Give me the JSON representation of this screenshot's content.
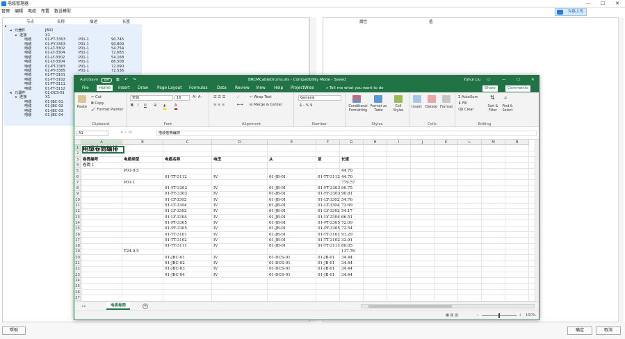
{
  "app": {
    "title": "电缆管理器",
    "window_controls": [
      "—",
      "☐",
      "✕"
    ],
    "menu": [
      "管理",
      "编辑",
      "电缆",
      "布置",
      "数设模型"
    ],
    "upload_button": "沟路上传",
    "left_headers": [
      "节点",
      "名称",
      "描述",
      "长度"
    ],
    "right_headers": [
      "属性",
      "值"
    ],
    "tree": [
      {
        "indent": 0,
        "toggle": "▸",
        "col1": "",
        "col2": "",
        "col3": "",
        "col4": ""
      },
      {
        "indent": 1,
        "toggle": "◂",
        "col1": "元器件",
        "col2": "JB01",
        "col3": "",
        "col4": ""
      },
      {
        "indent": 2,
        "toggle": "◂",
        "col1": "连接",
        "col2": "X1",
        "col3": "",
        "col4": ""
      },
      {
        "indent": 3,
        "toggle": "",
        "col1": "电缆",
        "col2": "01-FT-3303",
        "col3": "P01-1",
        "col4": "90.745"
      },
      {
        "indent": 3,
        "toggle": "",
        "col1": "电缆",
        "col2": "01-FY-3303",
        "col3": "P01-1",
        "col4": "90.809"
      },
      {
        "indent": 3,
        "toggle": "",
        "col1": "电缆",
        "col2": "01-LT-3302",
        "col3": "P01-1",
        "col4": "54.754"
      },
      {
        "indent": 3,
        "toggle": "",
        "col1": "电缆",
        "col2": "01-LT-3304",
        "col3": "P01-1",
        "col4": "72.683"
      },
      {
        "indent": 3,
        "toggle": "",
        "col1": "电缆",
        "col2": "01-LY-3302",
        "col3": "P01-1",
        "col4": "54.168"
      },
      {
        "indent": 3,
        "toggle": "",
        "col1": "电缆",
        "col2": "01-LY-3304",
        "col3": "P01-1",
        "col4": "66.508"
      },
      {
        "indent": 3,
        "toggle": "",
        "col1": "电缆",
        "col2": "01-PT-3305",
        "col3": "P01-1",
        "col4": "72.090"
      },
      {
        "indent": 3,
        "toggle": "",
        "col1": "电缆",
        "col2": "01-PY-3305",
        "col3": "P01-1",
        "col4": "72.536"
      },
      {
        "indent": 3,
        "toggle": "",
        "col1": "电缆",
        "col2": "01-TT-3101",
        "col3": "",
        "col4": ""
      },
      {
        "indent": 3,
        "toggle": "",
        "col1": "电缆",
        "col2": "01-TT-3102",
        "col3": "",
        "col4": ""
      },
      {
        "indent": 3,
        "toggle": "",
        "col1": "电缆",
        "col2": "01-TT-3111",
        "col3": "",
        "col4": ""
      },
      {
        "indent": 3,
        "toggle": "",
        "col1": "电缆",
        "col2": "01-TT-3112",
        "col3": "",
        "col4": ""
      },
      {
        "indent": 1,
        "toggle": "◂",
        "col1": "元器件",
        "col2": "01-DCS-01",
        "col3": "",
        "col4": ""
      },
      {
        "indent": 2,
        "toggle": "◂",
        "col1": "连接",
        "col2": "X1",
        "col3": "",
        "col4": ""
      },
      {
        "indent": 3,
        "toggle": "",
        "col1": "电缆",
        "col2": "01-JBC-01",
        "col3": "",
        "col4": ""
      },
      {
        "indent": 3,
        "toggle": "",
        "col1": "电缆",
        "col2": "01-JBC-02",
        "col3": "",
        "col4": ""
      },
      {
        "indent": 3,
        "toggle": "",
        "col1": "电缆",
        "col2": "01-JBC-03",
        "col3": "",
        "col4": ""
      },
      {
        "indent": 3,
        "toggle": "",
        "col1": "电缆",
        "col2": "01-JBC-04",
        "col3": "",
        "col4": ""
      }
    ],
    "footer": {
      "help": "帮助",
      "ok": "确定",
      "cancel": "取消"
    }
  },
  "excel": {
    "autosave": "AutoSave",
    "autosave_state": "Off",
    "file_title": "BRCMCableDrums.xls  -  Compatibility Mode  -  Saved",
    "user": "Yuhui Liu",
    "tabs": [
      "File",
      "Home",
      "Insert",
      "Draw",
      "Page Layout",
      "Formulas",
      "Data",
      "Review",
      "View",
      "Help",
      "ProjectWise"
    ],
    "active_tab": "Home",
    "tell_me": "Tell me what you want to do",
    "share": "Share",
    "comments": "Comments",
    "ribbon": {
      "paste": "Paste",
      "cut": "Cut",
      "copy": "Copy",
      "format_painter": "Format Painter",
      "clipboard": "Clipboard",
      "font_name": "宋体",
      "font_size": "16",
      "font": "Font",
      "wrap_text": "Wrap Text",
      "merge_center": "Merge & Center",
      "alignment": "Alignment",
      "number_format": "General",
      "number_symbols": "$ - % 9",
      "number": "Number",
      "conditional_formatting": "Conditional Formatting",
      "format_as_table": "Format as Table",
      "cell_styles": "Cell Styles",
      "styles": "Styles",
      "insert": "Insert",
      "delete": "Delete",
      "format": "Format",
      "cells": "Cells",
      "autosum": "AutoSum",
      "fill": "Fill",
      "clear": "Clear",
      "sort_filter": "Sort & Filter",
      "find_select": "Find & Select",
      "editing": "Editing"
    },
    "name_box": "A1",
    "formula": "电缆卷筒编排",
    "columns": [
      "A",
      "B",
      "C",
      "D",
      "E",
      "F",
      "G",
      "H",
      "I",
      "J",
      "K",
      "L",
      "M",
      "N"
    ],
    "rows": [
      {
        "n": "1",
        "a": "电缆卷筒编排",
        "b": "",
        "c": "",
        "d": "",
        "e": "",
        "f": "",
        "g": ""
      },
      {
        "n": "2",
        "a": "",
        "b": "",
        "c": "",
        "d": "",
        "e": "",
        "f": "",
        "g": ""
      },
      {
        "n": "3",
        "a": "卷筒编号",
        "b": "电缆类型",
        "c": "电缆名称",
        "d": "电压",
        "e": "从",
        "f": "至",
        "g": "长度"
      },
      {
        "n": "4",
        "a": "卷筒 1",
        "b": "",
        "c": "",
        "d": "",
        "e": "",
        "f": "",
        "g": ""
      },
      {
        "n": "5",
        "a": "",
        "b": "P01-0.5",
        "c": "",
        "d": "",
        "e": "",
        "f": "",
        "g": "44.70"
      },
      {
        "n": "6",
        "a": "",
        "b": "",
        "c": "01-TT-3112",
        "d": "IV",
        "e": "01-JB-01",
        "f": "01-TT-3112",
        "g": "44.70"
      },
      {
        "n": "7",
        "a": "",
        "b": "P01-1",
        "c": "",
        "d": "",
        "e": "",
        "f": "",
        "g": "779.57"
      },
      {
        "n": "8",
        "a": "",
        "b": "",
        "c": "01-FT-3303",
        "d": "IV",
        "e": "01-JB-01",
        "f": "01-FT-3303",
        "g": "90.75"
      },
      {
        "n": "9",
        "a": "",
        "b": "",
        "c": "01-FY-3303",
        "d": "IV",
        "e": "01-JB-01",
        "f": "01-FY-3303",
        "g": "90.81"
      },
      {
        "n": "10",
        "a": "",
        "b": "",
        "c": "01-LT-3302",
        "d": "IV",
        "e": "01-JB-01",
        "f": "01-LT-3302",
        "g": "54.76"
      },
      {
        "n": "11",
        "a": "",
        "b": "",
        "c": "01-LT-3304",
        "d": "IV",
        "e": "01-JB-01",
        "f": "01-LT-3304",
        "g": "72.69"
      },
      {
        "n": "12",
        "a": "",
        "b": "",
        "c": "01-LY-3302",
        "d": "IV",
        "e": "01-JB-01",
        "f": "01-LY-3302",
        "g": "54.17"
      },
      {
        "n": "13",
        "a": "",
        "b": "",
        "c": "01-LY-3304",
        "d": "IV",
        "e": "01-JB-01",
        "f": "01-LY-3304",
        "g": "66.51"
      },
      {
        "n": "14",
        "a": "",
        "b": "",
        "c": "01-PT-3305",
        "d": "IV",
        "e": "01-JB-01",
        "f": "01-PT-3305",
        "g": "72.09"
      },
      {
        "n": "15",
        "a": "",
        "b": "",
        "c": "01-PY-3305",
        "d": "IV",
        "e": "01-JB-01",
        "f": "01-PY-3305",
        "g": "72.54"
      },
      {
        "n": "16",
        "a": "",
        "b": "",
        "c": "01-TT-3101",
        "d": "IV",
        "e": "01-JB-01",
        "f": "01-TT-3101",
        "g": "91.29"
      },
      {
        "n": "17",
        "a": "",
        "b": "",
        "c": "01-TT-3102",
        "d": "IV",
        "e": "01-JB-01",
        "f": "01-TT-3102",
        "g": "33.91"
      },
      {
        "n": "18",
        "a": "",
        "b": "",
        "c": "01-TT-3111",
        "d": "IV",
        "e": "01-JB-01",
        "f": "01-TT-3111",
        "g": "80.05"
      },
      {
        "n": "19",
        "a": "",
        "b": "T24-0.5",
        "c": "",
        "d": "",
        "e": "",
        "f": "",
        "g": "137.76"
      },
      {
        "n": "20",
        "a": "",
        "b": "",
        "c": "01-JBC-01",
        "d": "IV",
        "e": "01-DCS-01",
        "f": "01-JB-01",
        "g": "34.44"
      },
      {
        "n": "21",
        "a": "",
        "b": "",
        "c": "01-JBC-02",
        "d": "IV",
        "e": "01-DCS-01",
        "f": "01-JB-01",
        "g": "34.44"
      },
      {
        "n": "22",
        "a": "",
        "b": "",
        "c": "01-JBC-03",
        "d": "IV",
        "e": "01-DCS-01",
        "f": "01-JB-01",
        "g": "34.44"
      },
      {
        "n": "23",
        "a": "",
        "b": "",
        "c": "01-JBC-04",
        "d": "IV",
        "e": "01-DCS-01",
        "f": "01-JB-01",
        "g": "34.44"
      },
      {
        "n": "24",
        "a": "",
        "b": "",
        "c": "",
        "d": "",
        "e": "",
        "f": "",
        "g": ""
      },
      {
        "n": "25",
        "a": "",
        "b": "",
        "c": "",
        "d": "",
        "e": "",
        "f": "",
        "g": ""
      },
      {
        "n": "26",
        "a": "",
        "b": "",
        "c": "",
        "d": "",
        "e": "",
        "f": "",
        "g": ""
      },
      {
        "n": "27",
        "a": "",
        "b": "",
        "c": "",
        "d": "",
        "e": "",
        "f": "",
        "g": ""
      }
    ],
    "sheet_tab": "电缆卷筒",
    "zoom": "100%",
    "colors": {
      "accent": "#217346",
      "selection": "#e6effc"
    }
  }
}
